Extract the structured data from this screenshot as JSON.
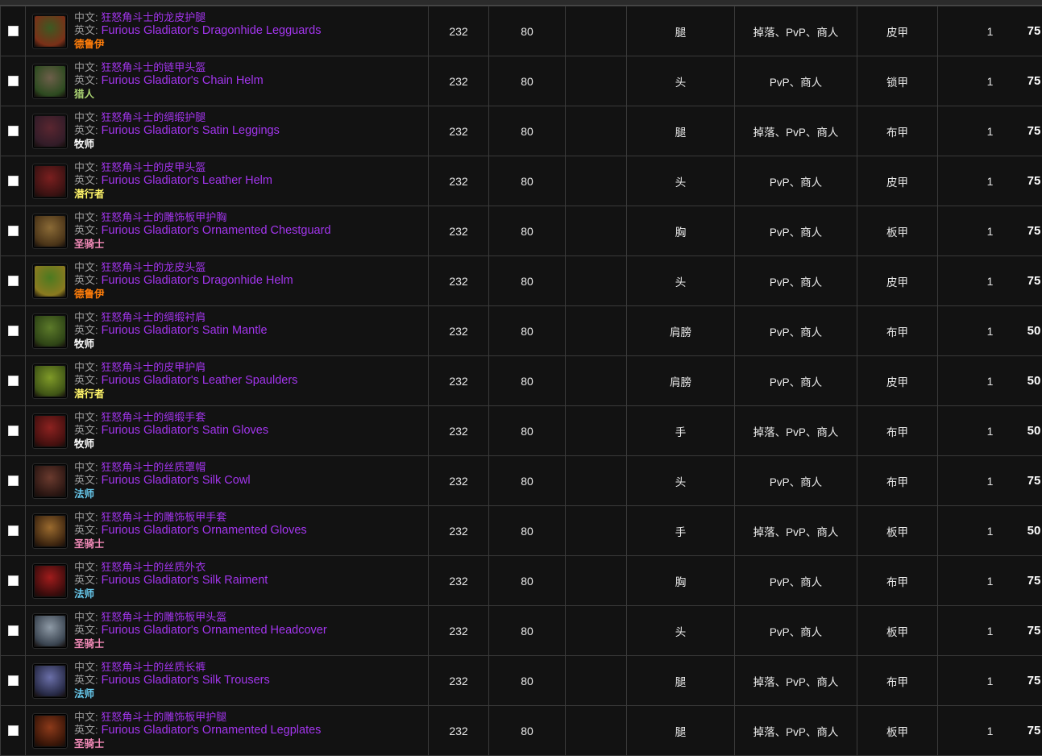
{
  "table": {
    "labels": {
      "cn": "中文:",
      "en": "英文:"
    },
    "currency_icon": "arena-points-icon",
    "class_colors": {
      "德鲁伊": "#ff7d0a",
      "猎人": "#abd473",
      "牧师": "#ffffff",
      "潜行者": "#fff569",
      "圣骑士": "#f58cba",
      "法师": "#69ccf0"
    },
    "rows": [
      {
        "checked": false,
        "icon_colors": [
          "#3c5a22",
          "#7a3018"
        ],
        "cn_name": "狂怒角斗士的龙皮护腿",
        "en_name": "Furious Gladiator's Dragonhide Legguards",
        "class": "德鲁伊",
        "ilvl": "232",
        "level": "80",
        "blank": "",
        "slot": "腿",
        "source": "掉落、PvP、商人",
        "armor": "皮甲",
        "qty": "1",
        "cost": "75"
      },
      {
        "checked": false,
        "icon_colors": [
          "#6d5f4a",
          "#2d4a20"
        ],
        "cn_name": "狂怒角斗士的链甲头盔",
        "en_name": "Furious Gladiator's Chain Helm",
        "class": "猎人",
        "ilvl": "232",
        "level": "80",
        "blank": "",
        "slot": "头",
        "source": "PvP、商人",
        "armor": "锁甲",
        "qty": "1",
        "cost": "75"
      },
      {
        "checked": false,
        "icon_colors": [
          "#5a2630",
          "#321c28"
        ],
        "cn_name": "狂怒角斗士的绸缎护腿",
        "en_name": "Furious Gladiator's Satin Leggings",
        "class": "牧师",
        "ilvl": "232",
        "level": "80",
        "blank": "",
        "slot": "腿",
        "source": "掉落、PvP、商人",
        "armor": "布甲",
        "qty": "1",
        "cost": "75"
      },
      {
        "checked": false,
        "icon_colors": [
          "#7a1f1f",
          "#3a1212"
        ],
        "cn_name": "狂怒角斗士的皮甲头盔",
        "en_name": "Furious Gladiator's Leather Helm",
        "class": "潜行者",
        "ilvl": "232",
        "level": "80",
        "blank": "",
        "slot": "头",
        "source": "PvP、商人",
        "armor": "皮甲",
        "qty": "1",
        "cost": "75"
      },
      {
        "checked": false,
        "icon_colors": [
          "#8a6a36",
          "#4a3418"
        ],
        "cn_name": "狂怒角斗士的雕饰板甲护胸",
        "en_name": "Furious Gladiator's Ornamented Chestguard",
        "class": "圣骑士",
        "ilvl": "232",
        "level": "80",
        "blank": "",
        "slot": "胸",
        "source": "PvP、商人",
        "armor": "板甲",
        "qty": "1",
        "cost": "75"
      },
      {
        "checked": false,
        "icon_colors": [
          "#4c7a20",
          "#8a7a20"
        ],
        "cn_name": "狂怒角斗士的龙皮头盔",
        "en_name": "Furious Gladiator's Dragonhide Helm",
        "class": "德鲁伊",
        "ilvl": "232",
        "level": "80",
        "blank": "",
        "slot": "头",
        "source": "PvP、商人",
        "armor": "皮甲",
        "qty": "1",
        "cost": "75"
      },
      {
        "checked": false,
        "icon_colors": [
          "#5c7a2a",
          "#2e4416"
        ],
        "cn_name": "狂怒角斗士的绸缎衬肩",
        "en_name": "Furious Gladiator's Satin Mantle",
        "class": "牧师",
        "ilvl": "232",
        "level": "80",
        "blank": "",
        "slot": "肩膀",
        "source": "PvP、商人",
        "armor": "布甲",
        "qty": "1",
        "cost": "50"
      },
      {
        "checked": false,
        "icon_colors": [
          "#7f9a28",
          "#3f5416"
        ],
        "cn_name": "狂怒角斗士的皮甲护肩",
        "en_name": "Furious Gladiator's Leather Spaulders",
        "class": "潜行者",
        "ilvl": "232",
        "level": "80",
        "blank": "",
        "slot": "肩膀",
        "source": "PvP、商人",
        "armor": "皮甲",
        "qty": "1",
        "cost": "50"
      },
      {
        "checked": false,
        "icon_colors": [
          "#8c2220",
          "#45100f"
        ],
        "cn_name": "狂怒角斗士的绸缎手套",
        "en_name": "Furious Gladiator's Satin Gloves",
        "class": "牧师",
        "ilvl": "232",
        "level": "80",
        "blank": "",
        "slot": "手",
        "source": "掉落、PvP、商人",
        "armor": "布甲",
        "qty": "1",
        "cost": "50"
      },
      {
        "checked": false,
        "icon_colors": [
          "#6a3a2e",
          "#2c1713"
        ],
        "cn_name": "狂怒角斗士的丝质罩帽",
        "en_name": "Furious Gladiator's Silk Cowl",
        "class": "法师",
        "ilvl": "232",
        "level": "80",
        "blank": "",
        "slot": "头",
        "source": "PvP、商人",
        "armor": "布甲",
        "qty": "1",
        "cost": "75"
      },
      {
        "checked": false,
        "icon_colors": [
          "#9a6a2e",
          "#3e2610"
        ],
        "cn_name": "狂怒角斗士的雕饰板甲手套",
        "en_name": "Furious Gladiator's Ornamented Gloves",
        "class": "圣骑士",
        "ilvl": "232",
        "level": "80",
        "blank": "",
        "slot": "手",
        "source": "掉落、PvP、商人",
        "armor": "板甲",
        "qty": "1",
        "cost": "50"
      },
      {
        "checked": false,
        "icon_colors": [
          "#a01c1c",
          "#3c0c0c"
        ],
        "cn_name": "狂怒角斗士的丝质外衣",
        "en_name": "Furious Gladiator's Silk Raiment",
        "class": "法师",
        "ilvl": "232",
        "level": "80",
        "blank": "",
        "slot": "胸",
        "source": "PvP、商人",
        "armor": "布甲",
        "qty": "1",
        "cost": "75"
      },
      {
        "checked": false,
        "icon_colors": [
          "#8e9aa6",
          "#3a4450"
        ],
        "cn_name": "狂怒角斗士的雕饰板甲头盔",
        "en_name": "Furious Gladiator's Ornamented Headcover",
        "class": "圣骑士",
        "ilvl": "232",
        "level": "80",
        "blank": "",
        "slot": "头",
        "source": "PvP、商人",
        "armor": "板甲",
        "qty": "1",
        "cost": "75"
      },
      {
        "checked": false,
        "icon_colors": [
          "#6a6fa8",
          "#272a46"
        ],
        "cn_name": "狂怒角斗士的丝质长裤",
        "en_name": "Furious Gladiator's Silk Trousers",
        "class": "法师",
        "ilvl": "232",
        "level": "80",
        "blank": "",
        "slot": "腿",
        "source": "掉落、PvP、商人",
        "armor": "布甲",
        "qty": "1",
        "cost": "75"
      },
      {
        "checked": false,
        "icon_colors": [
          "#8c3a1a",
          "#3a1608"
        ],
        "cn_name": "狂怒角斗士的雕饰板甲护腿",
        "en_name": "Furious Gladiator's Ornamented Legplates",
        "class": "圣骑士",
        "ilvl": "232",
        "level": "80",
        "blank": "",
        "slot": "腿",
        "source": "掉落、PvP、商人",
        "armor": "板甲",
        "qty": "1",
        "cost": "75"
      }
    ]
  }
}
